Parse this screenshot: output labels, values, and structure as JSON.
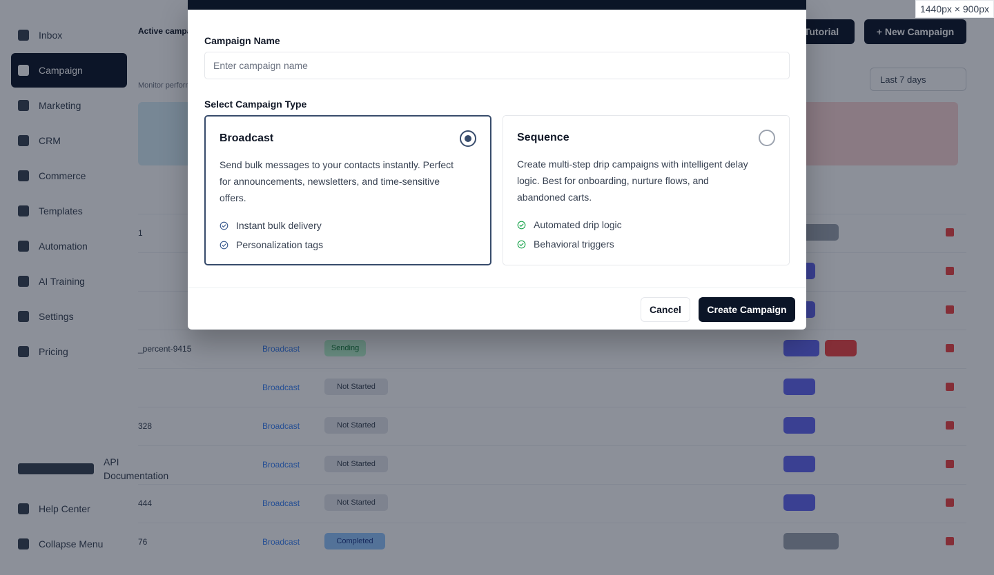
{
  "sidebar": {
    "items": [
      {
        "label": "Inbox",
        "icon": "inbox-icon"
      },
      {
        "label": "Campaign",
        "icon": "megaphone-icon",
        "active": true
      },
      {
        "label": "Marketing",
        "icon": "chart-icon"
      },
      {
        "label": "CRM",
        "icon": "contacts-icon"
      },
      {
        "label": "Commerce",
        "icon": "bag-icon"
      },
      {
        "label": "Templates",
        "icon": "template-icon"
      },
      {
        "label": "Automation",
        "icon": "bolt-icon"
      },
      {
        "label": "AI Training",
        "icon": "brain-icon"
      },
      {
        "label": "Settings",
        "icon": "gear-icon"
      },
      {
        "label": "Pricing",
        "icon": "card-icon"
      }
    ],
    "bottom_items": [
      {
        "label": "API Documentation",
        "icon": "doc-icon"
      },
      {
        "label": "Help Center",
        "icon": "help-icon"
      },
      {
        "label": "Collapse Menu",
        "icon": "collapse-icon"
      }
    ]
  },
  "background": {
    "header_title": "Active campaigns",
    "tutorial_label": "Tutorial",
    "new_campaign_label": "+ New Campaign",
    "subtitle": "Monitor performance",
    "range_select": "Last 7 days",
    "rows": [
      {
        "name": "1",
        "type": "",
        "status": ""
      },
      {
        "name": "",
        "type": "",
        "status": ""
      },
      {
        "name": "",
        "type": "",
        "status": ""
      },
      {
        "name": "_percent-9415",
        "type": "Broadcast",
        "status": "Sending"
      },
      {
        "name": "",
        "type": "Broadcast",
        "status": "Not Started"
      },
      {
        "name": "328",
        "type": "Broadcast",
        "status": "Not Started"
      },
      {
        "name": "",
        "type": "Broadcast",
        "status": "Not Started"
      },
      {
        "name": "444",
        "type": "Broadcast",
        "status": "Not Started"
      },
      {
        "name": "76",
        "type": "Broadcast",
        "status": "Completed"
      }
    ]
  },
  "modal": {
    "campaign_name_label": "Campaign Name",
    "campaign_name_placeholder": "Enter campaign name",
    "campaign_name_value": "",
    "select_type_label": "Select Campaign Type",
    "types": [
      {
        "title": "Broadcast",
        "selected": true,
        "description": "Send bulk messages to your contacts instantly. Perfect for announcements, newsletters, and time-sensitive offers.",
        "features": [
          "Instant bulk delivery",
          "Personalization tags"
        ],
        "feature_color": "#3b5b8f"
      },
      {
        "title": "Sequence",
        "selected": false,
        "description": "Create multi-step drip campaigns with intelligent delay logic. Best for onboarding, nurture flows, and abandoned carts.",
        "features": [
          "Automated drip logic",
          "Behavioral triggers"
        ],
        "feature_color": "#16a34a"
      }
    ],
    "cancel_label": "Cancel",
    "create_label": "Create Campaign"
  },
  "size_badge": "1440px × 900px",
  "colors": {
    "primary": "#0b1527",
    "selected_border": "#374b6b",
    "overlay": "rgba(15,23,42,0.48)"
  }
}
